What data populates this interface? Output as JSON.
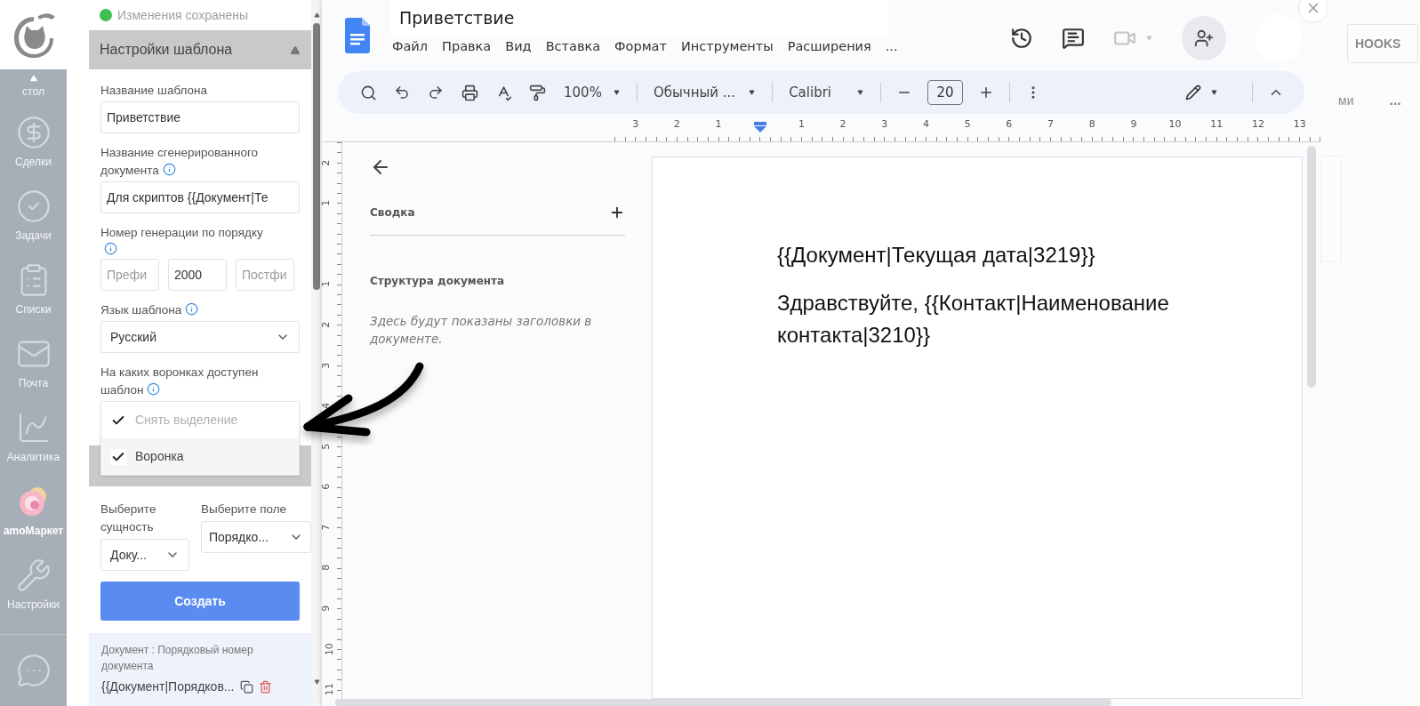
{
  "nav": {
    "items": [
      {
        "label": "стол",
        "selected": false
      },
      {
        "label": "Сделки",
        "selected": false
      },
      {
        "label": "Задачи",
        "selected": false
      },
      {
        "label": "Списки",
        "selected": false
      },
      {
        "label": "Почта",
        "selected": false
      },
      {
        "label": "Аналитика",
        "selected": false
      },
      {
        "label": "amoМаркет",
        "selected": true
      },
      {
        "label": "Настройки",
        "selected": false
      }
    ]
  },
  "panel": {
    "status": "Изменения сохранены",
    "section": {
      "title": "Настройки шаблона",
      "expanded": true
    },
    "template_name": {
      "label": "Название шаблона",
      "value": "Приветствие"
    },
    "document_name": {
      "label": "Название сгенерированного документа",
      "value": "Для скриптов {{Документ|Те"
    },
    "numbering": {
      "label": "Номер генерации по порядку",
      "prefix": {
        "placeholder": "Префи"
      },
      "number": {
        "value": "2000"
      },
      "suffix": {
        "placeholder": "Постфи"
      }
    },
    "language": {
      "label": "Язык шаблона",
      "value": "Русский"
    },
    "pipelines": {
      "label": "На каких воронках доступен шаблон",
      "options": [
        {
          "label": "Снять выделение",
          "checked": true,
          "disabled": true
        },
        {
          "label": "Воронка",
          "checked": true,
          "disabled": false
        }
      ]
    },
    "entity": {
      "label": "Выберите сущность",
      "value": "Доку..."
    },
    "field": {
      "label": "Выберите поле",
      "value": "Порядко..."
    },
    "create_button": "Создать",
    "variable": {
      "title": "Документ : Порядковый номер документа",
      "code": "{{Документ|Порядков..."
    }
  },
  "docs": {
    "title": "Приветствие",
    "menu": [
      "Файл",
      "Правка",
      "Вид",
      "Вставка",
      "Формат",
      "Инструменты",
      "Расширения",
      "..."
    ],
    "toolbar": {
      "zoom": "100%",
      "style": "Обычный ...",
      "font": "Calibri",
      "font_size": "20"
    },
    "ruler": {
      "horizontal": {
        "before_marker": [
          "3",
          "2",
          "1"
        ],
        "after_marker": [
          "1",
          "2",
          "3",
          "4",
          "5",
          "6",
          "7",
          "8",
          "9",
          "10",
          "11",
          "12",
          "13"
        ]
      },
      "vertical": {
        "before_marker": [
          "2",
          "1"
        ],
        "after_marker": [
          "1",
          "2",
          "3",
          "4",
          "5",
          "6",
          "7",
          "8",
          "9",
          "10",
          "11"
        ]
      }
    },
    "outline": {
      "summary": "Сводка",
      "structure": "Структура документа",
      "empty_hint": "Здесь будут показаны заголовки в документе."
    },
    "document": {
      "paragraphs": [
        "{{Документ|Текущая дата|3219}}",
        "Здравствуйте, {{Контакт|Наименование контакта|3210}}"
      ]
    }
  },
  "background": {
    "button": "HOOKS",
    "tab": "ми",
    "more": "..."
  }
}
